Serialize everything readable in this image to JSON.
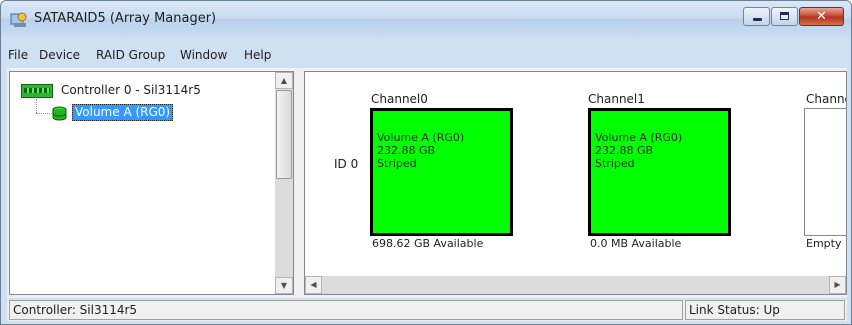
{
  "window": {
    "title": "SATARAID5 (Array Manager)",
    "close_glyph": "✕"
  },
  "menu": [
    "File",
    "Device",
    "RAID Group",
    "Window",
    "Help"
  ],
  "tree": {
    "controller_label": "Controller 0 - Sil3114r5",
    "volume_label": "Volume A (RG0)"
  },
  "array_view": {
    "channels": [
      "Channel0",
      "Channel1",
      "Channe"
    ],
    "row_label": "ID 0",
    "disks": [
      {
        "lines": [
          "Volume A (RG0)",
          "232.88 GB",
          "Striped"
        ],
        "available": "698.62 GB Available",
        "color": "#00ff00"
      },
      {
        "lines": [
          "Volume A (RG0)",
          "232.88 GB",
          "Striped"
        ],
        "available": "0.0 MB Available",
        "color": "#00ff00"
      },
      {
        "lines": [],
        "available": "Empty",
        "color": "#ffffff"
      }
    ]
  },
  "statusbar": {
    "controller": "Controller: Sil3114r5",
    "link_status": "Link Status: Up"
  },
  "icons": {
    "scroll_up": "▲",
    "scroll_down": "▼",
    "scroll_left": "◀",
    "scroll_right": "▶"
  },
  "colors": {
    "volume_green": "#00ff00",
    "selection_blue": "#3399ff",
    "title_gradient_top": "#dbe8f7"
  }
}
